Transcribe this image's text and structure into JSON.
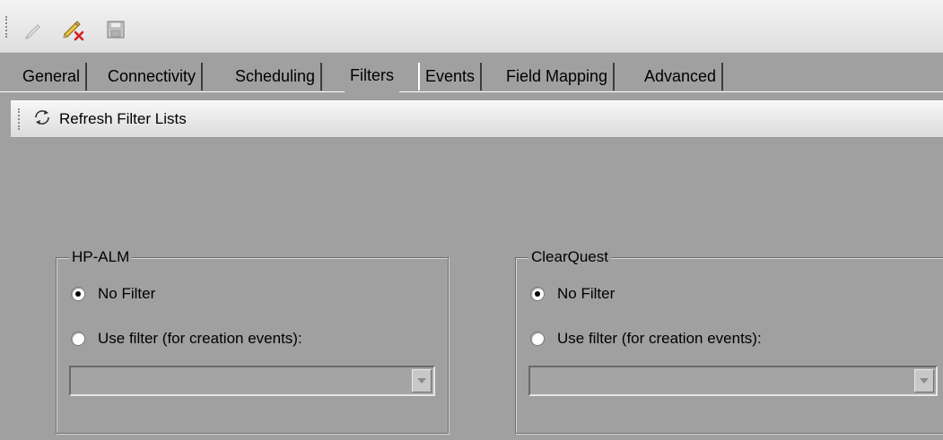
{
  "toolbar": {
    "icons": [
      "edit-pencil-icon",
      "clear-edit-icon",
      "save-disk-icon"
    ]
  },
  "tabs": [
    {
      "label": "General",
      "active": false
    },
    {
      "label": "Connectivity",
      "active": false
    },
    {
      "label": "Scheduling",
      "active": false
    },
    {
      "label": "Filters",
      "active": true
    },
    {
      "label": "Events",
      "active": false
    },
    {
      "label": "Field Mapping",
      "active": false
    },
    {
      "label": "Advanced",
      "active": false
    }
  ],
  "filters_toolbar": {
    "refresh_label": "Refresh Filter Lists",
    "refresh_icon": "refresh-icon"
  },
  "groups": [
    {
      "title": "HP-ALM",
      "no_filter_label": "No Filter",
      "use_filter_label": "Use filter (for creation events):",
      "selected": "No Filter",
      "filter_value": ""
    },
    {
      "title": "ClearQuest",
      "no_filter_label": "No Filter",
      "use_filter_label": "Use filter (for creation events):",
      "selected": "No Filter",
      "filter_value": ""
    }
  ],
  "colors": {
    "panel_background": "#a0a0a0",
    "toolbar_background": "#e8e8e8"
  }
}
